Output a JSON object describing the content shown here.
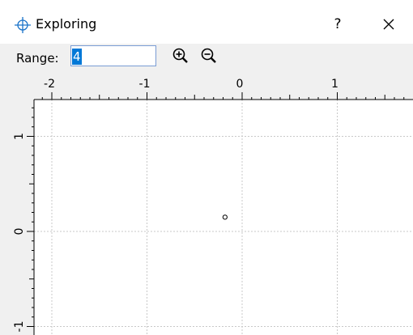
{
  "window": {
    "title": "Exploring",
    "title_icon": "crosshair-icon",
    "help_label": "?",
    "close_icon": "close-icon"
  },
  "toolbar": {
    "range_label": "Range:",
    "range_value": "4",
    "zoom_in_icon": "zoom-in-icon",
    "zoom_out_icon": "zoom-out-icon"
  },
  "chart_data": {
    "type": "scatter",
    "x_ticks": [
      "-2",
      "-1",
      "0",
      "1"
    ],
    "y_ticks": [
      "1",
      "0",
      "-1"
    ],
    "points": [
      {
        "x": -0.18,
        "y": 0.15
      }
    ],
    "grid": true
  }
}
